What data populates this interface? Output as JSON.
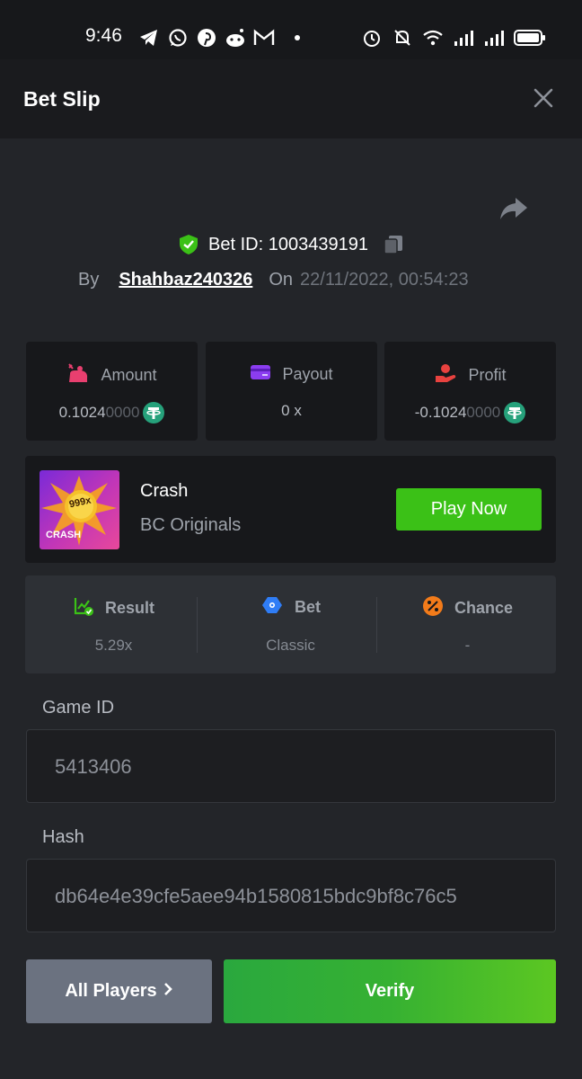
{
  "status_bar": {
    "time": "9:46",
    "left_icons": [
      "telegram-icon",
      "whatsapp-icon",
      "pinterest-icon",
      "reddit-icon",
      "gmail-icon",
      "dot-icon"
    ],
    "right_icons": [
      "alarm-icon",
      "bell-off-icon",
      "wifi-icon",
      "signal-icon",
      "signal-icon",
      "battery-icon"
    ]
  },
  "header": {
    "title": "Bet Slip"
  },
  "bet": {
    "id_label": "Bet ID: 1003439191",
    "by_label": "By",
    "user": "Shahbaz240326",
    "on_label": "On",
    "date": "22/11/2022, 00:54:23"
  },
  "stats": {
    "amount": {
      "label": "Amount",
      "value_main": "0.1024",
      "value_dim": "0000"
    },
    "payout": {
      "label": "Payout",
      "value": "0 x"
    },
    "profit": {
      "label": "Profit",
      "value_main": "-0.1024",
      "value_dim": "0000"
    }
  },
  "game": {
    "thumb_badge": "999x",
    "thumb_label": "CRASH",
    "name": "Crash",
    "provider": "BC Originals",
    "play_label": "Play Now"
  },
  "info": {
    "result": {
      "label": "Result",
      "value": "5.29x"
    },
    "bet": {
      "label": "Bet",
      "value": "Classic"
    },
    "chance": {
      "label": "Chance",
      "value": "-"
    }
  },
  "fields": {
    "game_id_label": "Game ID",
    "game_id_value": "5413406",
    "hash_label": "Hash",
    "hash_value": "db64e4e39cfe5aee94b1580815bdc9bf8c76c5"
  },
  "actions": {
    "players_label": "All Players",
    "verify_label": "Verify"
  },
  "colors": {
    "background": "#232529",
    "header": "#1a1b1e",
    "card": "#17181b",
    "accent_green": "#3bc117",
    "players_button": "#6b7280"
  }
}
